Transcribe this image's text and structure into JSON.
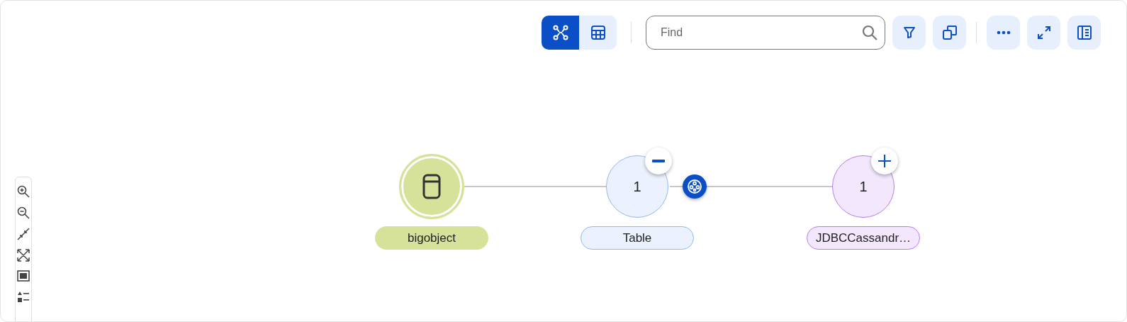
{
  "toolbar": {
    "view_modes": [
      {
        "kind": "graph",
        "selected": true
      },
      {
        "kind": "table",
        "selected": false
      }
    ],
    "search": {
      "placeholder": "Find"
    },
    "actions": [
      {
        "kind": "filter"
      },
      {
        "kind": "copy"
      },
      {
        "kind": "more"
      },
      {
        "kind": "expand"
      },
      {
        "kind": "panel"
      }
    ]
  },
  "zoom_controls": [
    {
      "kind": "zoom-in"
    },
    {
      "kind": "zoom-out"
    },
    {
      "kind": "collapse"
    },
    {
      "kind": "fit"
    },
    {
      "kind": "minimap"
    },
    {
      "kind": "legend"
    }
  ],
  "graph": {
    "nodes": [
      {
        "kind": "icon",
        "label": "bigobject",
        "color": "#d6e29a"
      },
      {
        "kind": "count",
        "count": "1",
        "label": "Table",
        "color": "#8fb6f5",
        "expanded": true
      },
      {
        "kind": "count",
        "count": "1",
        "label": "JDBCCassandr…",
        "color": "#b57bf0",
        "expanded": false
      }
    ]
  }
}
